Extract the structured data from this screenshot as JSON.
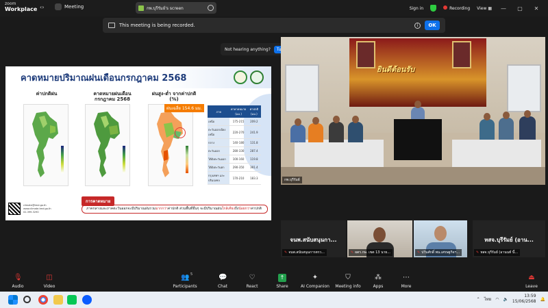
{
  "window": {
    "app_name_line1": "zoom",
    "app_name_line2": "Workplace",
    "meeting_label": "Meeting",
    "share_pill_label": "กพ.บุรีรัมย์'s screen",
    "sign_in": "Sign in",
    "recording": "Recording",
    "view": "View"
  },
  "recording_banner": {
    "text": "This meeting is being recorded.",
    "ok": "OK"
  },
  "audio_toast": {
    "text": "Not hearing anything?",
    "button": "Turn up volume",
    "close": "×"
  },
  "slide": {
    "title": "คาดหมายปริมาณฝนเดือนกรกฎาคม 2568",
    "col1": "ค่าปกติฝน",
    "col2_line1": "คาดหมายฝนเดือน",
    "col2_line2": "กรกฎาคม 2568",
    "col3_line1": "ฝนสูง-ต่ำ จากค่าปกติ",
    "col3_line2": "(%)",
    "badge": "ฝนเฉลี่ย 154.6 มม.",
    "table_headers": [
      "ภาค",
      "ค่าคาดหมาย (มม.)",
      "ค่าปกติ (มม.)"
    ],
    "table_rows": [
      [
        "เหนือ",
        "175-215",
        "209.2"
      ],
      [
        "ตะวันออกเฉียงเหนือ",
        "220-270",
        "241.9"
      ],
      [
        "กลาง",
        "140-180",
        "131.8"
      ],
      [
        "ตะวันออก",
        "280-330",
        "287.4"
      ],
      [
        "ใต้ฝั่งตะวันออก",
        "100-160",
        "119.8"
      ],
      [
        "ใต้ฝั่งตะวันตก",
        "290-350",
        "391.4"
      ],
      [
        "กรุงเทพฯ และปริมณฑล",
        "170-210",
        "183.3"
      ]
    ],
    "contact": [
      "climate@tmd.go.th",
      "www.climate.tmd.go.th",
      "02-399-3290"
    ],
    "forecast_tag": "การคาดหมาย",
    "forecast_text_a": "ภาคกลางและภาคตะวันออกจะมีปริมาณฝนรวม",
    "forecast_text_b": "มากกว่า",
    "forecast_text_c": "ค่าปกติ ส่วนพื้นที่อื่นๆ จะมีปริมาณฝน",
    "forecast_text_d": "ใกล้เคียง",
    "forecast_text_e": "ถึง",
    "forecast_text_f": "น้อยกว่า",
    "forecast_text_g": "ค่าปกติ"
  },
  "main_video": {
    "name": "กพ.บุรีรัมย์",
    "backdrop_text": "ยินดีต้อนรับ"
  },
  "participants": [
    {
      "display": "จนพ.สนับสนุนกา...",
      "label": "จนพ.สนับสนุนการตรว..."
    },
    {
      "display": "",
      "label": "ผตร.กษ. เขต 13 นาย..."
    },
    {
      "display": "",
      "label": "ปวันศักดิ์ พน.เศรษฐกิจฯ..."
    },
    {
      "display": "หสจ.บุรีรัมย์ (อาน...",
      "label": "หสจ.บุรีรัมย์ (อานนท์ นี้..."
    }
  ],
  "toolbar": {
    "audio": "Audio",
    "video": "Video",
    "participants": "Participants",
    "participants_count": "5",
    "chat": "Chat",
    "react": "React",
    "share": "Share",
    "ai": "AI Companion",
    "meeting_info": "Meeting info",
    "apps": "Apps",
    "more": "More",
    "leave": "Leave"
  },
  "taskbar": {
    "lang": "ไทย",
    "time": "13:59",
    "date": "15/06/2568"
  }
}
